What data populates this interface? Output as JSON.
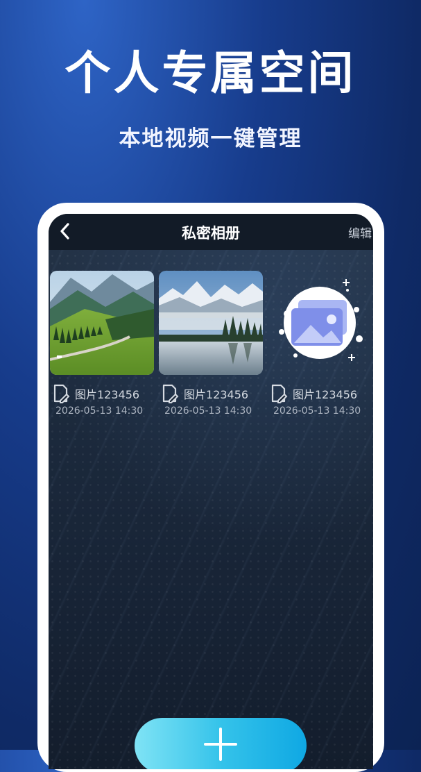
{
  "promo": {
    "headline": "个人专属空间",
    "subhead": "本地视频一键管理"
  },
  "app": {
    "title": "私密相册",
    "back_icon": "chevron-left-icon",
    "edit_label": "编辑"
  },
  "photos": [
    {
      "name": "图片123456",
      "date": "2026-05-13 14:30",
      "thumb": "mountain-valley-road"
    },
    {
      "name": "图片123456",
      "date": "2026-05-13 14:30",
      "thumb": "lake-mountain-reflection"
    },
    {
      "name": "图片123456",
      "date": "2026-05-13 14:30",
      "thumb": "image-placeholder-icon"
    }
  ],
  "add_button": {
    "icon": "plus-icon"
  },
  "colors": {
    "background": "#173c8c",
    "accent_start": "#7fe3f5",
    "accent_end": "#0fa8e3",
    "screen": "#1c2a3d"
  }
}
